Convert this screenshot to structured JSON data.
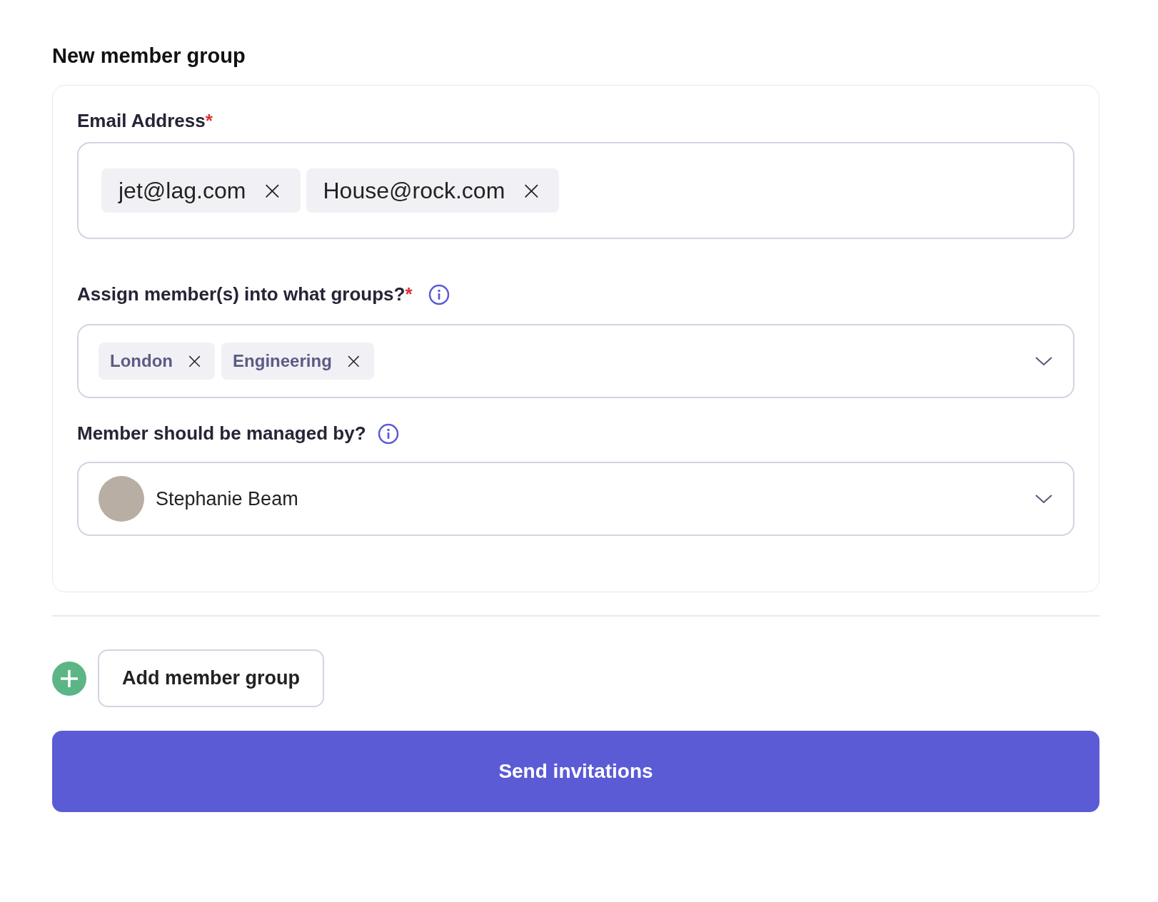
{
  "title": "New member group",
  "email": {
    "label": "Email Address",
    "required_mark": "*",
    "chips": [
      {
        "text": "jet@lag.com",
        "remove": "×"
      },
      {
        "text": "House@rock.com",
        "remove": "×"
      }
    ]
  },
  "groups": {
    "label": "Assign member(s) into what groups?",
    "required_mark": "*",
    "chips": [
      {
        "text": "London",
        "remove": "×"
      },
      {
        "text": "Engineering",
        "remove": "×"
      }
    ]
  },
  "manager": {
    "label": "Member should be managed by?",
    "value": "Stephanie Beam"
  },
  "add_button": "Add member group",
  "submit_button": "Send invitations"
}
